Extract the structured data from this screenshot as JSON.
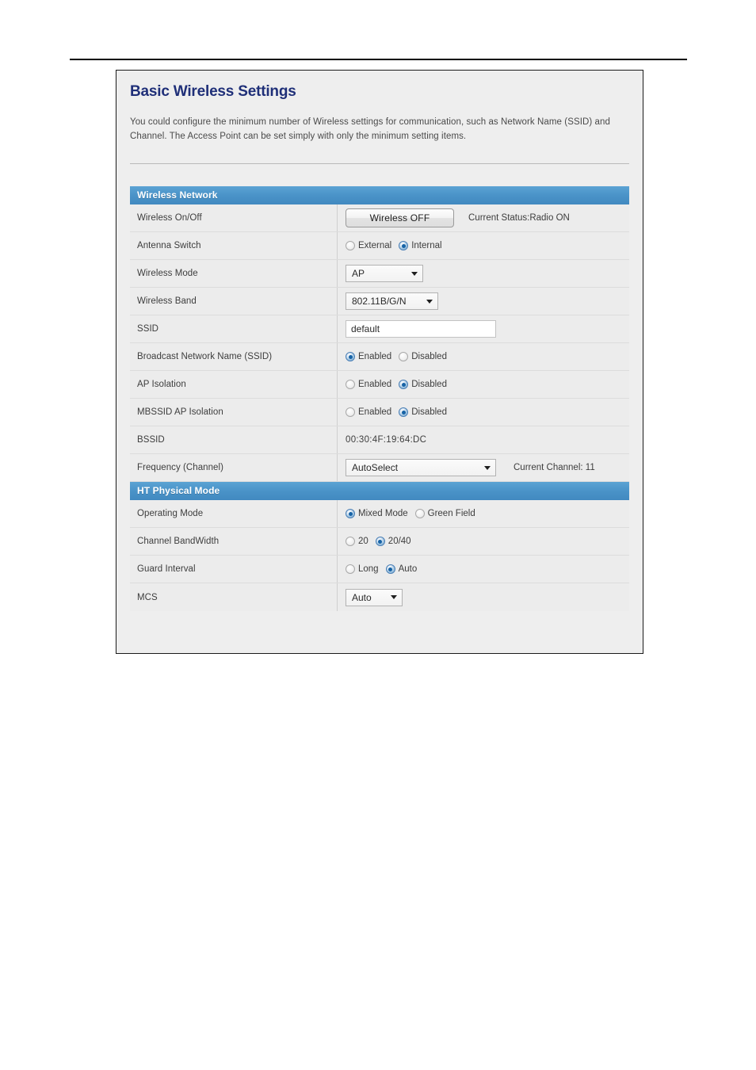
{
  "page": {
    "title": "Basic Wireless Settings",
    "description": "You could configure the minimum number of Wireless settings for communication, such as Network Name (SSID) and Channel. The Access Point can be set simply with only the minimum setting items."
  },
  "colors": {
    "section_header_bg": "#4a93c8",
    "title_text": "#1f2f78",
    "row_bg": "#ececec",
    "radio_selected": "#1763a6"
  },
  "sections": {
    "wireless_network": {
      "header": "Wireless Network",
      "rows": {
        "wireless_on_off": {
          "label": "Wireless On/Off",
          "button_label": "Wireless OFF",
          "status": "Current Status:Radio ON"
        },
        "antenna_switch": {
          "label": "Antenna Switch",
          "options": [
            "External",
            "Internal"
          ],
          "selected": "Internal"
        },
        "wireless_mode": {
          "label": "Wireless Mode",
          "value": "AP"
        },
        "wireless_band": {
          "label": "Wireless Band",
          "value": "802.11B/G/N"
        },
        "ssid": {
          "label": "SSID",
          "value": "default"
        },
        "broadcast_ssid": {
          "label": "Broadcast Network Name (SSID)",
          "options": [
            "Enabled",
            "Disabled"
          ],
          "selected": "Enabled"
        },
        "ap_isolation": {
          "label": "AP Isolation",
          "options": [
            "Enabled",
            "Disabled"
          ],
          "selected": "Disabled"
        },
        "mbssid_ap_isolation": {
          "label": "MBSSID AP Isolation",
          "options": [
            "Enabled",
            "Disabled"
          ],
          "selected": "Disabled"
        },
        "bssid": {
          "label": "BSSID",
          "value": "00:30:4F:19:64:DC"
        },
        "frequency_channel": {
          "label": "Frequency (Channel)",
          "value": "AutoSelect",
          "note": "Current Channel: 11"
        }
      }
    },
    "ht_physical_mode": {
      "header": "HT Physical Mode",
      "rows": {
        "operating_mode": {
          "label": "Operating Mode",
          "options": [
            "Mixed Mode",
            "Green Field"
          ],
          "selected": "Mixed Mode"
        },
        "channel_bandwidth": {
          "label": "Channel BandWidth",
          "options": [
            "20",
            "20/40"
          ],
          "selected": "20/40"
        },
        "guard_interval": {
          "label": "Guard Interval",
          "options": [
            "Long",
            "Auto"
          ],
          "selected": "Auto"
        },
        "mcs": {
          "label": "MCS",
          "value": "Auto"
        }
      }
    }
  }
}
